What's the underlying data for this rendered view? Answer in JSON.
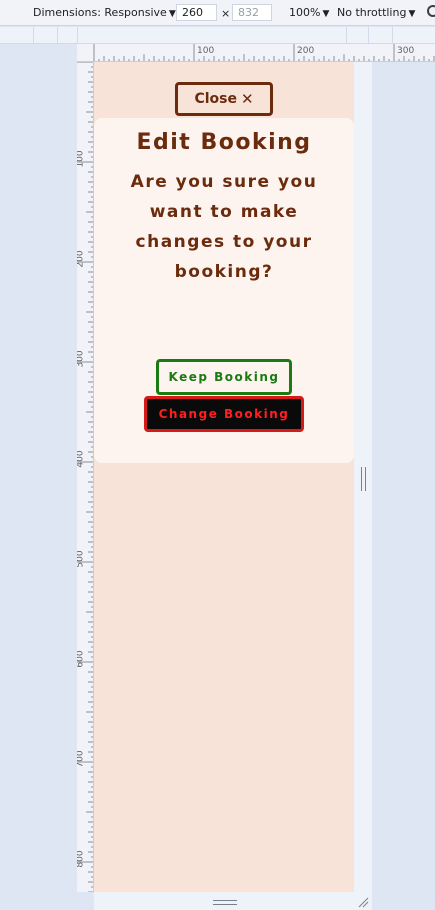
{
  "toolbar": {
    "dimensions_label": "Dimensions: Responsive",
    "width_value": "260",
    "times_sign": "×",
    "height_placeholder": "832",
    "zoom_label": "100%",
    "throttling_label": "No throttling",
    "caret": "▼"
  },
  "ruler": {
    "top_labels": [
      "100",
      "200",
      "300"
    ],
    "left_labels": [
      "100",
      "200",
      "300",
      "400",
      "500",
      "600",
      "700",
      "800"
    ]
  },
  "page": {
    "close_label": "Close",
    "close_icon": "✕",
    "title": "Edit Booking",
    "message": "Are you sure you want to make changes to your booking?",
    "keep_label": "Keep Booking",
    "change_label": "Change Booking"
  },
  "colors": {
    "page_bg": "#f8e3d9",
    "card_bg": "#fdf3ef",
    "brand_brown": "#6b2b0d",
    "keep_green": "#1c7a12",
    "change_red": "#ff1f1f",
    "change_bg": "#0a0a0a"
  }
}
